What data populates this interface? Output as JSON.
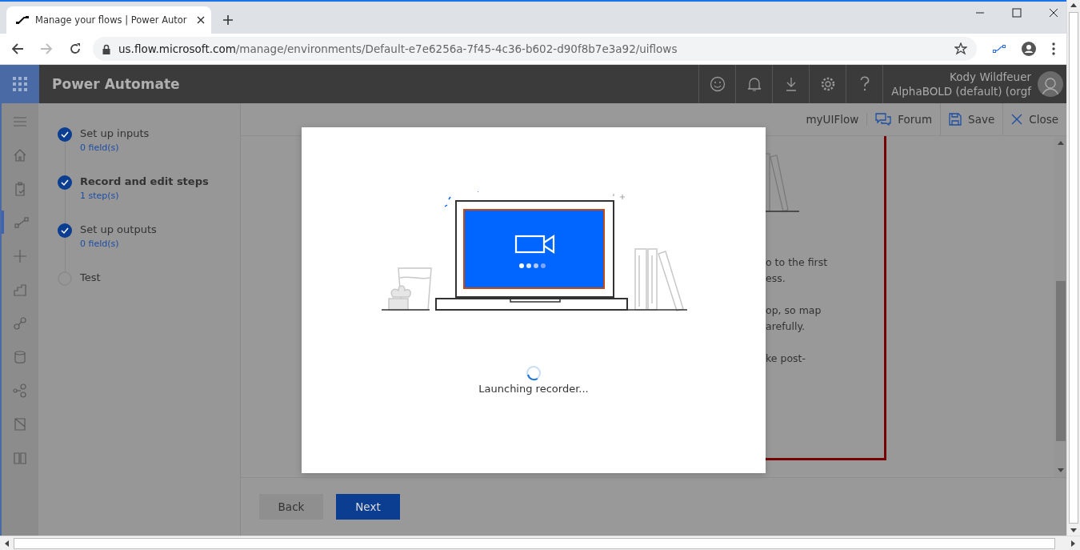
{
  "browser": {
    "tab": {
      "title": "Manage your flows | Power Autor"
    },
    "url": {
      "host": "us.flow.microsoft.com",
      "path": "/manage/environments/Default-e7e6256a-7f45-4c36-b602-d90f8b7e3a92/uiflows"
    }
  },
  "app": {
    "name": "Power Automate",
    "user": {
      "name": "Kody Wildfeuer",
      "org": "AlphaBOLD (default) (orgf"
    }
  },
  "rail": [
    {
      "kind": "menu",
      "selected": false
    },
    {
      "kind": "home",
      "selected": false
    },
    {
      "kind": "clipboard",
      "selected": false
    },
    {
      "kind": "flow",
      "selected": true
    },
    {
      "kind": "plus",
      "selected": false
    },
    {
      "kind": "stairs",
      "selected": false
    },
    {
      "kind": "connector",
      "selected": false
    },
    {
      "kind": "database",
      "selected": false
    },
    {
      "kind": "nodes",
      "selected": false
    },
    {
      "kind": "page",
      "selected": false
    },
    {
      "kind": "book",
      "selected": false
    }
  ],
  "steps": [
    {
      "title": "Set up inputs",
      "detail": "0 field(s)",
      "done": true,
      "current": false
    },
    {
      "title": "Record and edit steps",
      "detail": "1 step(s)",
      "done": true,
      "current": true
    },
    {
      "title": "Set up outputs",
      "detail": "0 field(s)",
      "done": true,
      "current": false
    },
    {
      "title": "Test",
      "done": false,
      "current": false
    }
  ],
  "command_bar": {
    "flow_name": "myUIFlow",
    "actions": [
      {
        "kind": "forum",
        "label": "Forum"
      },
      {
        "kind": "save",
        "label": "Save"
      },
      {
        "kind": "close",
        "label": "Close"
      }
    ]
  },
  "background_card": {
    "paragraphs": [
      [
        "o to the first",
        "ess."
      ],
      [
        "op, so map",
        "arefully."
      ],
      [
        "ke post-"
      ]
    ]
  },
  "dialog": {
    "status": "Launching recorder..."
  },
  "footer": {
    "buttons": [
      {
        "kind": "secondary",
        "label": "Back"
      },
      {
        "kind": "primary",
        "label": "Next"
      }
    ]
  }
}
